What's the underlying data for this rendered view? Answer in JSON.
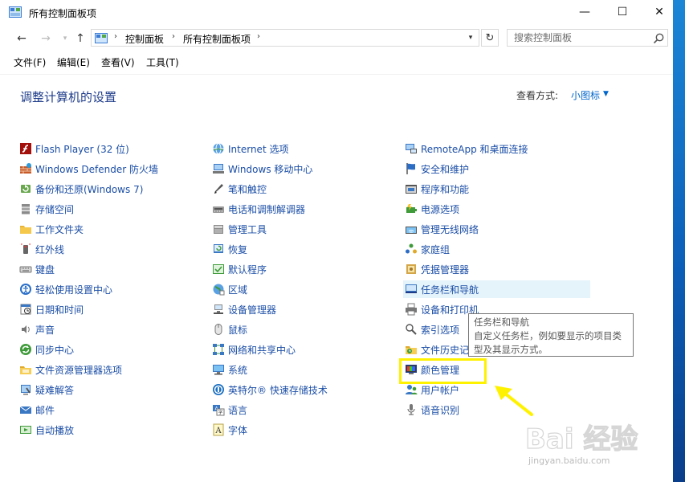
{
  "window": {
    "title": "所有控制面板项"
  },
  "caption": {
    "min": "—",
    "max": "☐",
    "close": "✕"
  },
  "nav": {
    "back": "←",
    "forward": "→",
    "up": "↑",
    "crumbs": [
      "控制面板",
      "所有控制面板项"
    ],
    "refresh": "↻",
    "search_placeholder": "搜索控制面板"
  },
  "menu": [
    "文件(F)",
    "编辑(E)",
    "查看(V)",
    "工具(T)"
  ],
  "page": {
    "title": "调整计算机的设置",
    "view_label": "查看方式:",
    "view_value": "小图标"
  },
  "columns": [
    [
      {
        "label": "Flash Player (32 位)",
        "icon": "flash-player-icon"
      },
      {
        "label": "Windows Defender 防火墙",
        "icon": "firewall-icon"
      },
      {
        "label": "备份和还原(Windows 7)",
        "icon": "backup-icon"
      },
      {
        "label": "存储空间",
        "icon": "storage-icon"
      },
      {
        "label": "工作文件夹",
        "icon": "work-folders-icon"
      },
      {
        "label": "红外线",
        "icon": "infrared-icon"
      },
      {
        "label": "键盘",
        "icon": "keyboard-icon"
      },
      {
        "label": "轻松使用设置中心",
        "icon": "ease-of-access-icon"
      },
      {
        "label": "日期和时间",
        "icon": "date-time-icon"
      },
      {
        "label": "声音",
        "icon": "sound-icon"
      },
      {
        "label": "同步中心",
        "icon": "sync-center-icon"
      },
      {
        "label": "文件资源管理器选项",
        "icon": "folder-options-icon"
      },
      {
        "label": "疑难解答",
        "icon": "troubleshooting-icon"
      },
      {
        "label": "邮件",
        "icon": "mail-icon"
      },
      {
        "label": "自动播放",
        "icon": "autoplay-icon"
      }
    ],
    [
      {
        "label": "Internet 选项",
        "icon": "internet-options-icon"
      },
      {
        "label": "Windows 移动中心",
        "icon": "mobility-center-icon"
      },
      {
        "label": "笔和触控",
        "icon": "pen-touch-icon"
      },
      {
        "label": "电话和调制解调器",
        "icon": "phone-modem-icon"
      },
      {
        "label": "管理工具",
        "icon": "admin-tools-icon"
      },
      {
        "label": "恢复",
        "icon": "recovery-icon"
      },
      {
        "label": "默认程序",
        "icon": "default-programs-icon"
      },
      {
        "label": "区域",
        "icon": "region-icon"
      },
      {
        "label": "设备管理器",
        "icon": "device-manager-icon"
      },
      {
        "label": "鼠标",
        "icon": "mouse-icon"
      },
      {
        "label": "网络和共享中心",
        "icon": "network-icon"
      },
      {
        "label": "系统",
        "icon": "system-icon"
      },
      {
        "label": "英特尔® 快速存储技术",
        "icon": "intel-rst-icon"
      },
      {
        "label": "语言",
        "icon": "language-icon"
      },
      {
        "label": "字体",
        "icon": "fonts-icon"
      }
    ],
    [
      {
        "label": "RemoteApp 和桌面连接",
        "icon": "remoteapp-icon"
      },
      {
        "label": "安全和维护",
        "icon": "security-flag-icon"
      },
      {
        "label": "程序和功能",
        "icon": "programs-icon"
      },
      {
        "label": "电源选项",
        "icon": "power-icon"
      },
      {
        "label": "管理无线网络",
        "icon": "wireless-icon"
      },
      {
        "label": "家庭组",
        "icon": "homegroup-icon"
      },
      {
        "label": "凭据管理器",
        "icon": "credential-icon"
      },
      {
        "label": "任务栏和导航",
        "icon": "taskbar-icon"
      },
      {
        "label": "设备和打印机",
        "icon": "printer-icon"
      },
      {
        "label": "索引选项",
        "icon": "indexing-icon"
      },
      {
        "label": "文件历史记录",
        "icon": "file-history-icon"
      },
      {
        "label": "颜色管理",
        "icon": "color-management-icon"
      },
      {
        "label": "用户帐户",
        "icon": "user-accounts-icon"
      },
      {
        "label": "语音识别",
        "icon": "speech-icon"
      }
    ]
  ],
  "tooltip": {
    "title": "任务栏和导航",
    "body": "自定义任务栏，例如要显示的项目类型及其显示方式。"
  },
  "watermark": {
    "brand": "Bai 经验",
    "url": "jingyan.baidu.com"
  },
  "colors": {
    "link": "#1b4ea6",
    "title": "#1e3c8a",
    "highlight": "#fff200",
    "hover": "#e5f3fb",
    "accent": "#0066cc"
  }
}
